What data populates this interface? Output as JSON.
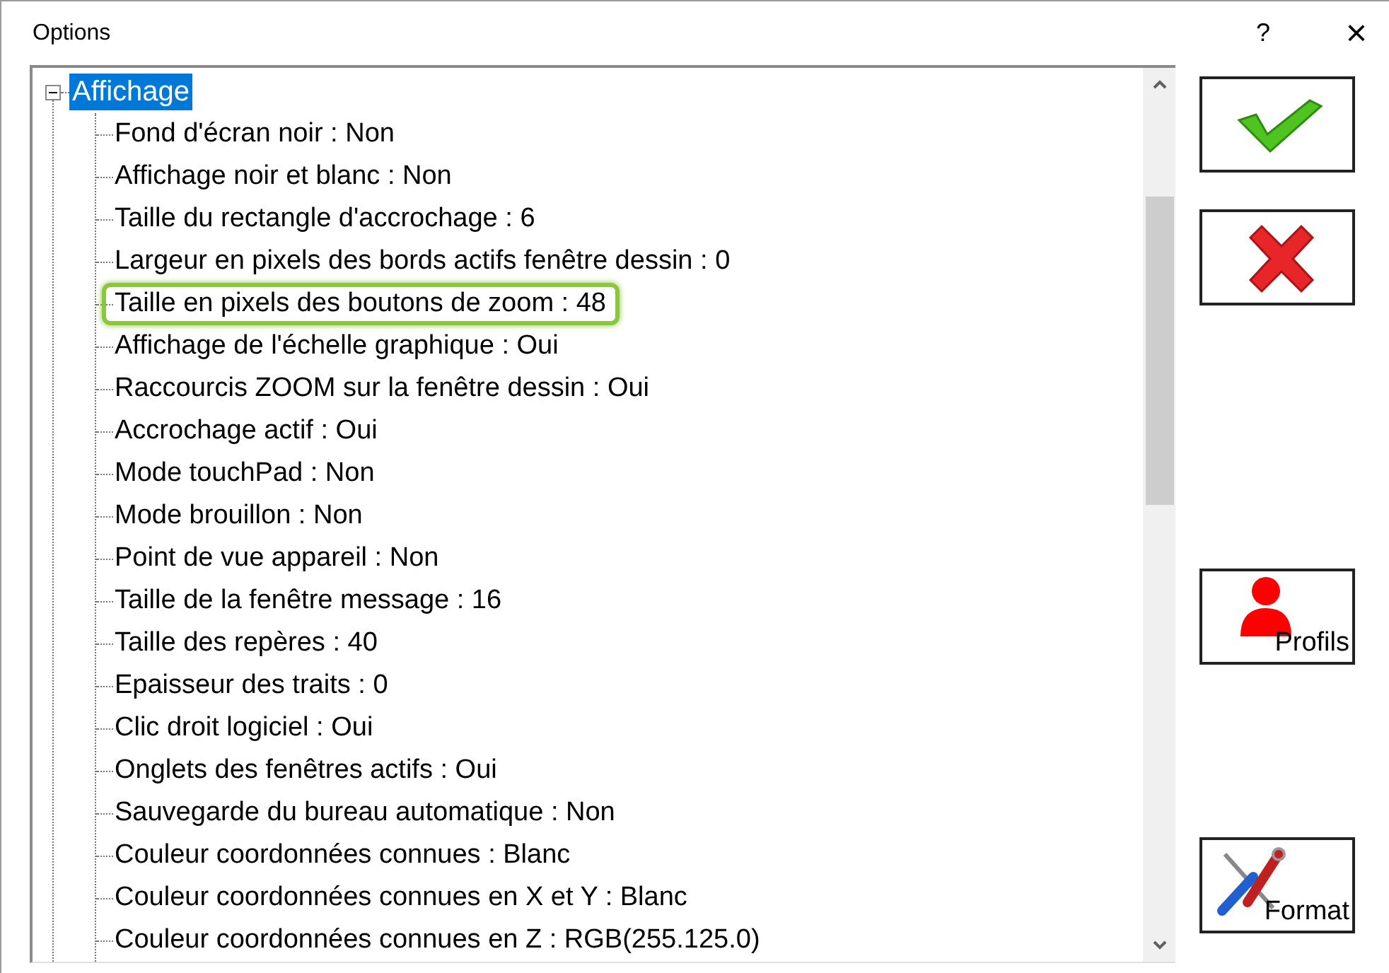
{
  "window": {
    "title": "Options",
    "help": "?",
    "close": "×"
  },
  "tree": {
    "label": "Affichage",
    "selected": true,
    "expanded": true,
    "children": [
      {
        "label": "Fond d'écran noir : Non",
        "highlighted": false
      },
      {
        "label": "Affichage noir et blanc : Non",
        "highlighted": false
      },
      {
        "label": "Taille du rectangle d'accrochage : 6",
        "highlighted": false
      },
      {
        "label": "Largeur en pixels des bords actifs fenêtre dessin : 0",
        "highlighted": false
      },
      {
        "label": "Taille en pixels des boutons de zoom : 48",
        "highlighted": true
      },
      {
        "label": "Affichage de l'échelle graphique : Oui",
        "highlighted": false
      },
      {
        "label": "Raccourcis ZOOM sur la fenêtre dessin : Oui",
        "highlighted": false
      },
      {
        "label": "Accrochage actif : Oui",
        "highlighted": false
      },
      {
        "label": "Mode touchPad : Non",
        "highlighted": false
      },
      {
        "label": "Mode brouillon : Non",
        "highlighted": false
      },
      {
        "label": "Point de vue appareil : Non",
        "highlighted": false
      },
      {
        "label": "Taille de la fenêtre message : 16",
        "highlighted": false
      },
      {
        "label": "Taille des repères : 40",
        "highlighted": false
      },
      {
        "label": "Epaisseur des traits : 0",
        "highlighted": false
      },
      {
        "label": "Clic droit logiciel : Oui",
        "highlighted": false
      },
      {
        "label": "Onglets des fenêtres actifs : Oui",
        "highlighted": false
      },
      {
        "label": "Sauvegarde du bureau automatique : Non",
        "highlighted": false
      },
      {
        "label": "Couleur coordonnées connues : Blanc",
        "highlighted": false
      },
      {
        "label": "Couleur coordonnées connues en X et Y : Blanc",
        "highlighted": false
      },
      {
        "label": "Couleur coordonnées connues en Z : RGB(255.125.0)",
        "highlighted": false
      }
    ]
  },
  "buttons": [
    {
      "kind": "ok"
    },
    {
      "kind": "cancel"
    },
    {
      "kind": "profile",
      "label": "Profils"
    },
    {
      "kind": "format",
      "label": "Format"
    }
  ]
}
